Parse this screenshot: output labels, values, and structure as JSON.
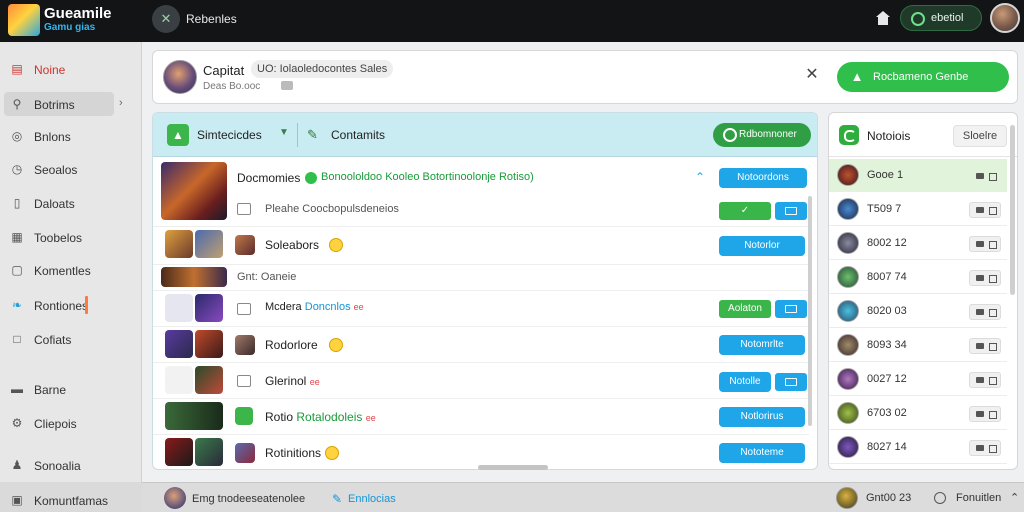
{
  "app": {
    "title": "Gueamile",
    "subtitle": "Gamu gias",
    "nav_label": "Rebenles"
  },
  "topbar": {
    "status_label": "ebetiol"
  },
  "sidebar": {
    "items": [
      {
        "label": "Noine",
        "icon": "home-icon"
      },
      {
        "label": "Botrims",
        "icon": "search-icon"
      },
      {
        "label": "Bnlons",
        "icon": "compass-icon"
      },
      {
        "label": "Seoalos",
        "icon": "clock-icon"
      },
      {
        "label": "Daloats",
        "icon": "document-icon"
      },
      {
        "label": "Toobelos",
        "icon": "calendar-icon"
      },
      {
        "label": "Komentles",
        "icon": "chat-icon"
      },
      {
        "label": "Rontiones",
        "icon": "leaf-icon"
      },
      {
        "label": "Cofiats",
        "icon": "square-icon"
      },
      {
        "label": "Barne",
        "icon": "folder-icon"
      },
      {
        "label": "Cliepois",
        "icon": "settings-icon"
      },
      {
        "label": "Sonoalia",
        "icon": "users-icon"
      },
      {
        "label": "Komuntfamas",
        "icon": "grid-icon"
      }
    ]
  },
  "header": {
    "title": "Capitat",
    "chip": "UO: Iolaoledocontes Sales",
    "subtitle": "Deas Bo.ooc",
    "primary_button": "Rocbameno Genbe"
  },
  "toolbar": {
    "select_label": "Simtecicdes",
    "contacts_label": "Contamits",
    "action_button": "Rdbomnoner"
  },
  "rows": [
    {
      "title": "Docmomies",
      "desc": "Bonoololdoo Kooleo Botortinoolonje Rotiso)",
      "button": "Notoordons",
      "sub": "Pleahe Coocbopulsdeneios"
    },
    {
      "title": "Soleabors",
      "button": "Notorlor"
    },
    {
      "title": "Gnt: Oaneie"
    },
    {
      "title": "Mcdera",
      "accent": "Doncnlos",
      "tag": "ee",
      "green_button": "Aolaton"
    },
    {
      "title": "Rodorlore",
      "button": "Notomrlte"
    },
    {
      "title": "Glerinol",
      "tag": "ee",
      "button": "Notolle"
    },
    {
      "title": "Rotio",
      "accent": "Rotalodoleis",
      "tag": "ee",
      "button": "Notlorirus"
    },
    {
      "title": "Rotinitions",
      "button": "Nototeme"
    }
  ],
  "right_panel": {
    "title": "Notoiois",
    "button": "Sloelre",
    "items": [
      {
        "label": "Gooe  1"
      },
      {
        "label": "T509  7"
      },
      {
        "label": "8002  12"
      },
      {
        "label": "8007  74"
      },
      {
        "label": "8020  03"
      },
      {
        "label": "8093  34"
      },
      {
        "label": "0027  12"
      },
      {
        "label": "6703  02"
      },
      {
        "label": "8027  14"
      }
    ]
  },
  "bottombar": {
    "input_text": "Emg tnodeeseatenolee",
    "link_label": "Ennlocias",
    "right_label": "Gnt00 23",
    "right_action": "Fonuitlen"
  },
  "colors": {
    "accent_green": "#2fbf4a",
    "accent_blue": "#1fa6e8",
    "topbar": "#121416"
  }
}
